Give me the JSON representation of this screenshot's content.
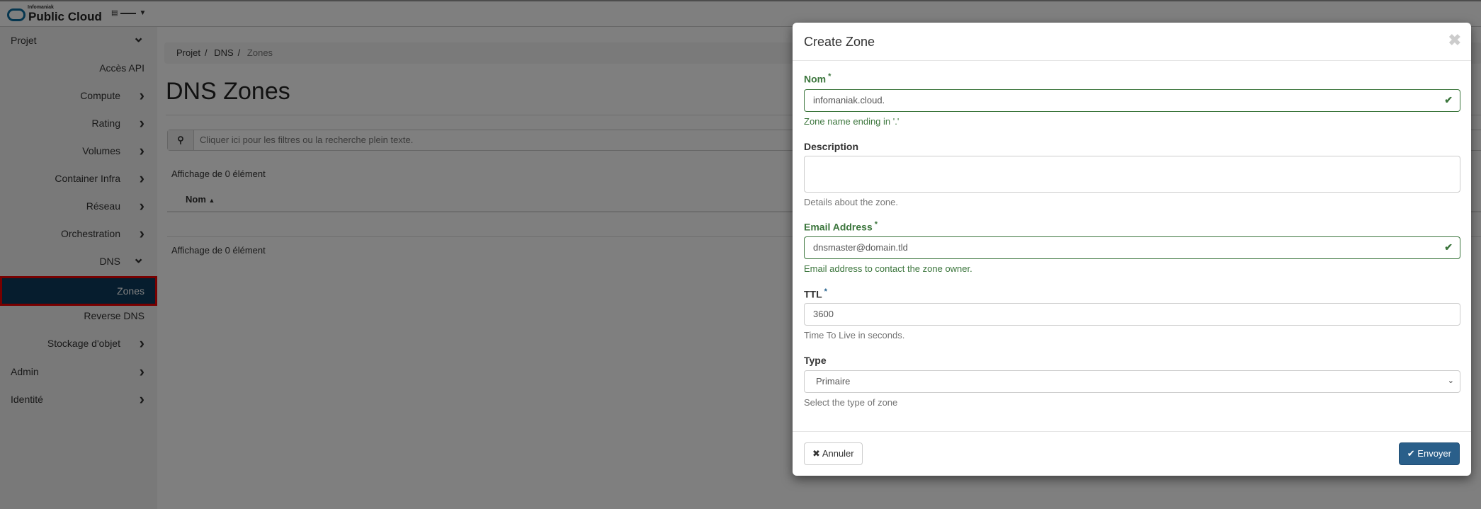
{
  "brand": {
    "small": "Infomaniak",
    "name": "Public Cloud"
  },
  "sidebar": {
    "items": [
      {
        "label": "Projet",
        "icon": "chevron-down"
      },
      {
        "label": "Accès API"
      },
      {
        "label": "Compute",
        "icon": "chevron-right"
      },
      {
        "label": "Rating",
        "icon": "chevron-right"
      },
      {
        "label": "Volumes",
        "icon": "chevron-right"
      },
      {
        "label": "Container Infra",
        "icon": "chevron-right"
      },
      {
        "label": "Réseau",
        "icon": "chevron-right"
      },
      {
        "label": "Orchestration",
        "icon": "chevron-right"
      },
      {
        "label": "DNS",
        "icon": "chevron-down"
      },
      {
        "label": "Zones",
        "active": true
      },
      {
        "label": "Reverse DNS"
      },
      {
        "label": "Stockage d'objet",
        "icon": "chevron-right"
      },
      {
        "label": "Admin",
        "icon": "chevron-right"
      },
      {
        "label": "Identité",
        "icon": "chevron-right"
      }
    ]
  },
  "breadcrumb": [
    "Projet",
    "DNS",
    "Zones"
  ],
  "page": {
    "title": "DNS Zones",
    "search_placeholder": "Cliquer ici pour les filtres ou la recherche plein texte.",
    "count_text": "Affichage de 0 élément",
    "column": "Nom"
  },
  "modal": {
    "title": "Create Zone",
    "fields": {
      "name": {
        "label": "Nom",
        "value": "infomaniak.cloud.",
        "help": "Zone name ending in '.'"
      },
      "description": {
        "label": "Description",
        "value": "",
        "help": "Details about the zone."
      },
      "email": {
        "label": "Email Address",
        "value": "dnsmaster@domain.tld",
        "help": "Email address to contact the zone owner."
      },
      "ttl": {
        "label": "TTL",
        "value": "3600",
        "help": "Time To Live in seconds."
      },
      "type": {
        "label": "Type",
        "value": "Primaire",
        "help": "Select the type of zone"
      }
    },
    "cancel": "Annuler",
    "submit": "Envoyer"
  },
  "colors": {
    "success": "#3c763d",
    "primary": "#2a5f8a",
    "active_nav": "#0d3a5c",
    "highlight": "#ee0000"
  }
}
